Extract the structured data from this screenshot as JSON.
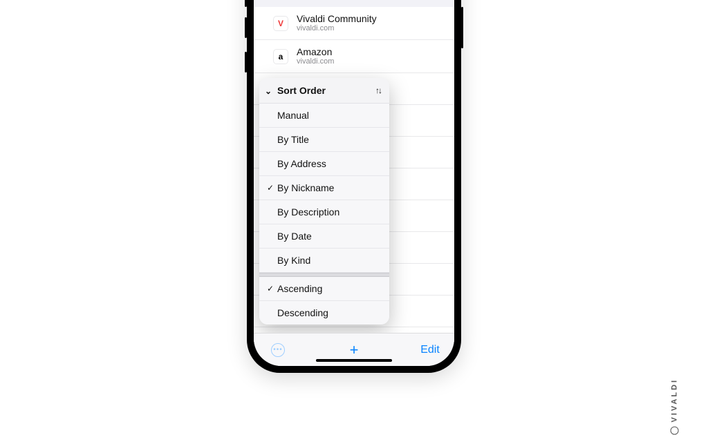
{
  "watermark": "VIVALDI",
  "bookmarks": [
    {
      "title": "Vivaldi Community",
      "subtitle": "vivaldi.com",
      "icon": "V",
      "icon_variant": "vred"
    },
    {
      "title": "Amazon",
      "subtitle": "vivaldi.com",
      "icon": "a",
      "icon_variant": ""
    }
  ],
  "toolbar": {
    "edit_label": "Edit"
  },
  "sort_menu": {
    "header": "Sort Order",
    "options": [
      {
        "label": "Manual",
        "checked": false
      },
      {
        "label": "By Title",
        "checked": false
      },
      {
        "label": "By Address",
        "checked": false
      },
      {
        "label": "By Nickname",
        "checked": true
      },
      {
        "label": "By Description",
        "checked": false
      },
      {
        "label": "By Date",
        "checked": false
      },
      {
        "label": "By Kind",
        "checked": false
      }
    ],
    "direction": [
      {
        "label": "Ascending",
        "checked": true
      },
      {
        "label": "Descending",
        "checked": false
      }
    ]
  }
}
